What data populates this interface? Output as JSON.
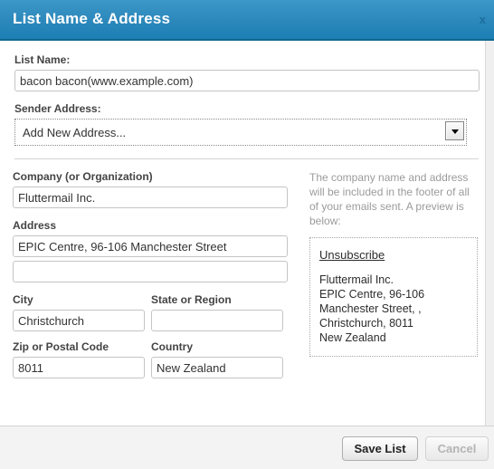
{
  "dialog": {
    "title": "List Name & Address",
    "close_label": "x"
  },
  "form": {
    "list_name": {
      "label": "List Name:",
      "value": "bacon bacon(www.example.com)"
    },
    "sender_address": {
      "label": "Sender Address:",
      "selected": "Add New Address...",
      "options": [
        "Add New Address..."
      ]
    },
    "company": {
      "label": "Company (or Organization)",
      "value": "Fluttermail Inc."
    },
    "address": {
      "label": "Address",
      "line1": "EPIC Centre, 96-106 Manchester Street",
      "line2": ""
    },
    "city": {
      "label": "City",
      "value": "Christchurch"
    },
    "state": {
      "label": "State or Region",
      "value": ""
    },
    "zip": {
      "label": "Zip or Postal Code",
      "value": "8011"
    },
    "country": {
      "label": "Country",
      "value": "New Zealand"
    }
  },
  "preview": {
    "helper_text": "The company name and address will be included in the footer of all of your emails sent. A preview is below:",
    "unsubscribe_label": "Unsubscribe",
    "lines": [
      "Fluttermail Inc.",
      "EPIC Centre, 96-106",
      "Manchester Street, ,",
      "Christchurch, 8011",
      "New Zealand"
    ]
  },
  "footer": {
    "save_label": "Save List",
    "cancel_label": "Cancel"
  },
  "colors": {
    "header_top": "#3c98c9",
    "header_bottom": "#1c7fb4",
    "header_border": "#10688f",
    "label_text": "#444444",
    "helper_text": "#9b9b9b",
    "footer_bg": "#f3f3f3"
  }
}
